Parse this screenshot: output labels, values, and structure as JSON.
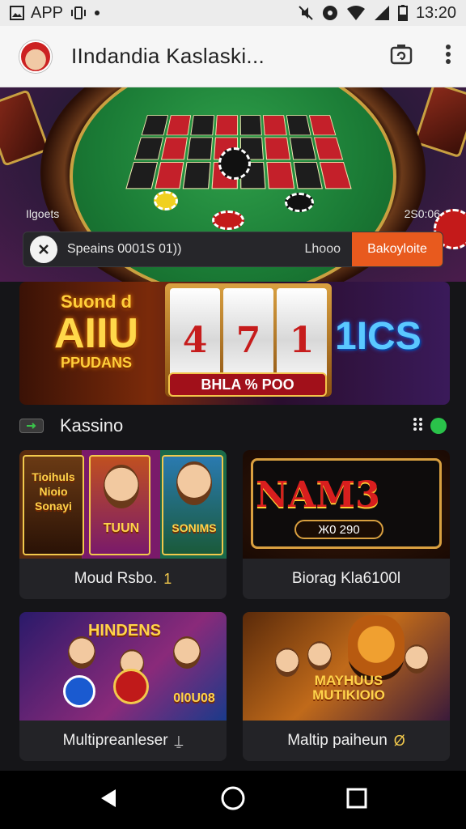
{
  "status_bar": {
    "app_label": "APP",
    "time": "13:20",
    "icons": [
      "image-icon",
      "vibrate-icon",
      "dot-icon",
      "mute-icon",
      "location-icon",
      "wifi-icon",
      "signal-icon",
      "battery-icon"
    ]
  },
  "app_bar": {
    "title": "IIndandia Kaslaski...",
    "icons": [
      "avatar",
      "camera-switch-icon",
      "more-vert-icon"
    ]
  },
  "hero": {
    "label_left": "Ilgoets",
    "label_right": "2S0:06",
    "search_text": "Speains 0001S 01))",
    "search_mid": "Lhooo",
    "search_button": "Bakoyloite"
  },
  "banner": {
    "left_line1": "Suond d",
    "left_line2": "AIIU",
    "left_line3": "PPUDANS",
    "reel_1": "4",
    "reel_2": "7",
    "reel_3": "1",
    "strip": "BHLA % POO",
    "right_text": "1ICS"
  },
  "section": {
    "title": "Kassino"
  },
  "games": [
    {
      "label": "Moud Rsbo.",
      "mark": "1",
      "art_text_1": "Tioihuls Nioio Sonayi",
      "art_text_2": "TUUN",
      "art_text_3": "SONIMS"
    },
    {
      "label": "Biorag Kla6100l",
      "mark": "",
      "art_text_1": "NAM3",
      "art_text_2": "Ж0 290"
    },
    {
      "label": "Multipreanleser",
      "mark": "⍊",
      "art_text_1": "HINDENS",
      "art_text_2": "0l0U08"
    },
    {
      "label": "Maltip paiheun",
      "mark": "Ø",
      "art_text_1": "MAYHUUS MUTIKIOIO"
    }
  ],
  "nav_bar": {
    "icons": [
      "back-icon",
      "home-icon",
      "recents-icon"
    ]
  },
  "colors": {
    "accent": "#e85a1e",
    "background": "#151518",
    "card": "#232327",
    "gold": "#f2c94c"
  }
}
